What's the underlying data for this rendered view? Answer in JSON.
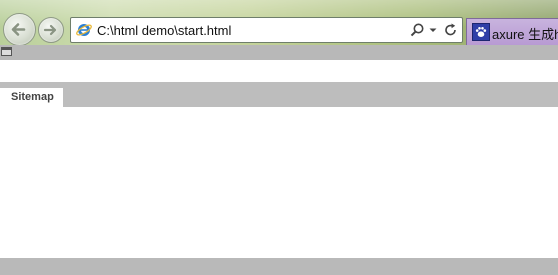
{
  "browser": {
    "address_bar": {
      "url": "C:\\html demo\\start.html"
    },
    "tab": {
      "title": "axure 生成ht"
    },
    "icons": {
      "back": "back-arrow-icon",
      "forward": "forward-arrow-icon",
      "page": "ie-page-icon",
      "search": "search-icon",
      "dropdown": "chevron-down-icon",
      "refresh": "refresh-icon",
      "favicon": "baidu-paw-icon"
    }
  },
  "page": {
    "tabs": [
      {
        "label": "Sitemap"
      }
    ]
  },
  "colors": {
    "strip_gray": "#b8b8b8",
    "tab_purple": "#b89bd3"
  }
}
